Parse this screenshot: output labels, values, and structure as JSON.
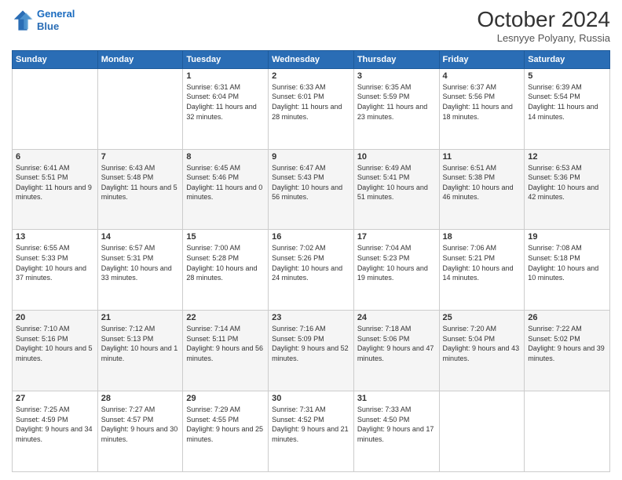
{
  "header": {
    "logo_line1": "General",
    "logo_line2": "Blue",
    "title": "October 2024",
    "subtitle": "Lesnyye Polyany, Russia"
  },
  "weekdays": [
    "Sunday",
    "Monday",
    "Tuesday",
    "Wednesday",
    "Thursday",
    "Friday",
    "Saturday"
  ],
  "weeks": [
    [
      {
        "day": "",
        "text": ""
      },
      {
        "day": "",
        "text": ""
      },
      {
        "day": "1",
        "text": "Sunrise: 6:31 AM\nSunset: 6:04 PM\nDaylight: 11 hours and 32 minutes."
      },
      {
        "day": "2",
        "text": "Sunrise: 6:33 AM\nSunset: 6:01 PM\nDaylight: 11 hours and 28 minutes."
      },
      {
        "day": "3",
        "text": "Sunrise: 6:35 AM\nSunset: 5:59 PM\nDaylight: 11 hours and 23 minutes."
      },
      {
        "day": "4",
        "text": "Sunrise: 6:37 AM\nSunset: 5:56 PM\nDaylight: 11 hours and 18 minutes."
      },
      {
        "day": "5",
        "text": "Sunrise: 6:39 AM\nSunset: 5:54 PM\nDaylight: 11 hours and 14 minutes."
      }
    ],
    [
      {
        "day": "6",
        "text": "Sunrise: 6:41 AM\nSunset: 5:51 PM\nDaylight: 11 hours and 9 minutes."
      },
      {
        "day": "7",
        "text": "Sunrise: 6:43 AM\nSunset: 5:48 PM\nDaylight: 11 hours and 5 minutes."
      },
      {
        "day": "8",
        "text": "Sunrise: 6:45 AM\nSunset: 5:46 PM\nDaylight: 11 hours and 0 minutes."
      },
      {
        "day": "9",
        "text": "Sunrise: 6:47 AM\nSunset: 5:43 PM\nDaylight: 10 hours and 56 minutes."
      },
      {
        "day": "10",
        "text": "Sunrise: 6:49 AM\nSunset: 5:41 PM\nDaylight: 10 hours and 51 minutes."
      },
      {
        "day": "11",
        "text": "Sunrise: 6:51 AM\nSunset: 5:38 PM\nDaylight: 10 hours and 46 minutes."
      },
      {
        "day": "12",
        "text": "Sunrise: 6:53 AM\nSunset: 5:36 PM\nDaylight: 10 hours and 42 minutes."
      }
    ],
    [
      {
        "day": "13",
        "text": "Sunrise: 6:55 AM\nSunset: 5:33 PM\nDaylight: 10 hours and 37 minutes."
      },
      {
        "day": "14",
        "text": "Sunrise: 6:57 AM\nSunset: 5:31 PM\nDaylight: 10 hours and 33 minutes."
      },
      {
        "day": "15",
        "text": "Sunrise: 7:00 AM\nSunset: 5:28 PM\nDaylight: 10 hours and 28 minutes."
      },
      {
        "day": "16",
        "text": "Sunrise: 7:02 AM\nSunset: 5:26 PM\nDaylight: 10 hours and 24 minutes."
      },
      {
        "day": "17",
        "text": "Sunrise: 7:04 AM\nSunset: 5:23 PM\nDaylight: 10 hours and 19 minutes."
      },
      {
        "day": "18",
        "text": "Sunrise: 7:06 AM\nSunset: 5:21 PM\nDaylight: 10 hours and 14 minutes."
      },
      {
        "day": "19",
        "text": "Sunrise: 7:08 AM\nSunset: 5:18 PM\nDaylight: 10 hours and 10 minutes."
      }
    ],
    [
      {
        "day": "20",
        "text": "Sunrise: 7:10 AM\nSunset: 5:16 PM\nDaylight: 10 hours and 5 minutes."
      },
      {
        "day": "21",
        "text": "Sunrise: 7:12 AM\nSunset: 5:13 PM\nDaylight: 10 hours and 1 minute."
      },
      {
        "day": "22",
        "text": "Sunrise: 7:14 AM\nSunset: 5:11 PM\nDaylight: 9 hours and 56 minutes."
      },
      {
        "day": "23",
        "text": "Sunrise: 7:16 AM\nSunset: 5:09 PM\nDaylight: 9 hours and 52 minutes."
      },
      {
        "day": "24",
        "text": "Sunrise: 7:18 AM\nSunset: 5:06 PM\nDaylight: 9 hours and 47 minutes."
      },
      {
        "day": "25",
        "text": "Sunrise: 7:20 AM\nSunset: 5:04 PM\nDaylight: 9 hours and 43 minutes."
      },
      {
        "day": "26",
        "text": "Sunrise: 7:22 AM\nSunset: 5:02 PM\nDaylight: 9 hours and 39 minutes."
      }
    ],
    [
      {
        "day": "27",
        "text": "Sunrise: 7:25 AM\nSunset: 4:59 PM\nDaylight: 9 hours and 34 minutes."
      },
      {
        "day": "28",
        "text": "Sunrise: 7:27 AM\nSunset: 4:57 PM\nDaylight: 9 hours and 30 minutes."
      },
      {
        "day": "29",
        "text": "Sunrise: 7:29 AM\nSunset: 4:55 PM\nDaylight: 9 hours and 25 minutes."
      },
      {
        "day": "30",
        "text": "Sunrise: 7:31 AM\nSunset: 4:52 PM\nDaylight: 9 hours and 21 minutes."
      },
      {
        "day": "31",
        "text": "Sunrise: 7:33 AM\nSunset: 4:50 PM\nDaylight: 9 hours and 17 minutes."
      },
      {
        "day": "",
        "text": ""
      },
      {
        "day": "",
        "text": ""
      }
    ]
  ]
}
